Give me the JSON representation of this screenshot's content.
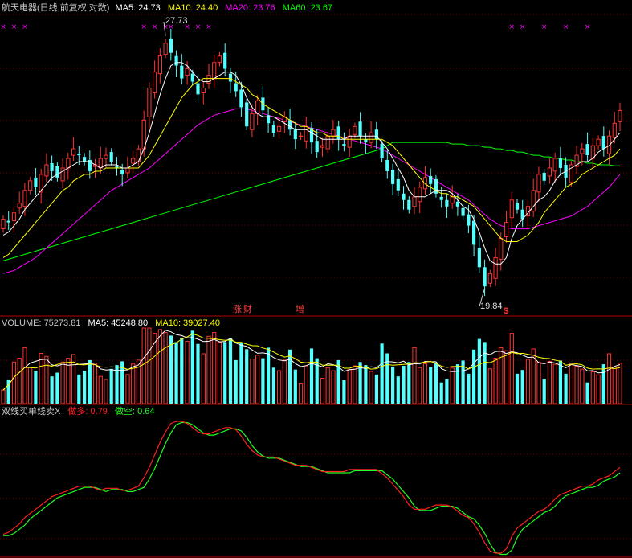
{
  "colors": {
    "background": "#000000",
    "up": "#ff3232",
    "down": "#54ffff",
    "ma5": "#ffffff",
    "ma10": "#ffff00",
    "ma20": "#ff00ff",
    "ma60": "#00ff00",
    "grid": "#7a0000",
    "divider": "#b00000",
    "label": "#c0c0c0",
    "red_line": "#ff2020",
    "green_line": "#20ff20"
  },
  "price_panel": {
    "title": "航天电器(日线,前复权,对数)",
    "ma5_label": "MA5: 24.73",
    "ma10_label": "MA10: 24.40",
    "ma20_label": "MA20: 23.76",
    "ma60_label": "MA60: 23.67",
    "high_label": "27.73",
    "low_label": "19.84",
    "markers": [
      "涨",
      "财",
      "增",
      "$"
    ]
  },
  "volume_panel": {
    "volume_label": "VOLUME: 75273.81",
    "ma5_label": "MA5: 45248.80",
    "ma10_label": "MA10: 39027.40"
  },
  "indicator_panel": {
    "title": "双线买单线卖X",
    "long_label": "做多: 0.79",
    "short_label": "做空: 0.64"
  },
  "chart_data": [
    {
      "type": "candlestick",
      "title": "航天电器(日线,前复权,对数)",
      "y_range": [
        19.0,
        28.4
      ],
      "annotations": {
        "high": 27.73,
        "low": 19.84
      },
      "close": [
        22.0,
        21.9,
        22.2,
        22.5,
        22.9,
        23.2,
        23.0,
        23.4,
        23.7,
        23.5,
        23.3,
        23.6,
        23.9,
        24.2,
        24.0,
        23.8,
        23.5,
        23.7,
        23.9,
        24.0,
        23.8,
        23.6,
        23.4,
        23.6,
        23.9,
        24.2,
        25.1,
        26.1,
        26.6,
        27.1,
        27.5,
        27.2,
        26.8,
        26.4,
        26.7,
        26.3,
        25.9,
        26.1,
        26.5,
        26.9,
        27.1,
        26.7,
        26.3,
        26.0,
        25.5,
        24.9,
        25.3,
        25.7,
        25.4,
        25.0,
        24.7,
        24.9,
        25.2,
        24.8,
        24.5,
        24.6,
        24.9,
        24.4,
        24.1,
        24.3,
        24.6,
        24.8,
        24.5,
        24.3,
        24.6,
        24.9,
        24.6,
        24.4,
        24.7,
        24.5,
        23.9,
        23.5,
        23.1,
        22.9,
        22.6,
        22.3,
        22.7,
        23.0,
        23.3,
        23.1,
        22.8,
        22.6,
        22.4,
        22.7,
        22.4,
        22.1,
        21.8,
        21.2,
        20.5,
        19.9,
        20.3,
        20.8,
        21.4,
        21.9,
        22.6,
        22.3,
        22.0,
        22.4,
        22.9,
        23.4,
        23.2,
        23.6,
        23.9,
        23.6,
        23.3,
        23.7,
        24.0,
        24.2,
        24.0,
        24.3,
        24.5,
        24.2,
        24.6,
        25.0,
        25.4
      ],
      "ma5": [
        21.5,
        21.6,
        21.8,
        22.0,
        22.3,
        22.5,
        22.7,
        22.9,
        23.1,
        23.3,
        23.4,
        23.5,
        23.6,
        23.7,
        23.8,
        23.8,
        23.8,
        23.7,
        23.6,
        23.7,
        23.7,
        23.7,
        23.6,
        23.6,
        23.7,
        23.8,
        24.2,
        24.7,
        25.3,
        25.9,
        26.4,
        26.8,
        26.9,
        26.9,
        26.8,
        26.6,
        26.4,
        26.3,
        26.3,
        26.4,
        26.5,
        26.6,
        26.6,
        26.5,
        26.2,
        25.8,
        25.5,
        25.3,
        25.2,
        25.2,
        25.2,
        25.1,
        25.0,
        24.9,
        24.8,
        24.8,
        24.8,
        24.7,
        24.6,
        24.5,
        24.5,
        24.5,
        24.5,
        24.5,
        24.6,
        24.6,
        24.6,
        24.6,
        24.6,
        24.6,
        24.4,
        24.2,
        23.9,
        23.6,
        23.3,
        22.9,
        22.7,
        22.7,
        22.7,
        22.8,
        22.9,
        22.9,
        22.9,
        22.8,
        22.6,
        22.4,
        22.3,
        22.0,
        21.6,
        21.1,
        20.7,
        20.6,
        20.6,
        20.8,
        21.4,
        21.8,
        22.0,
        22.2,
        22.4,
        22.6,
        22.7,
        22.9,
        23.2,
        23.4,
        23.5,
        23.6,
        23.7,
        23.8,
        23.8,
        23.9,
        24.1,
        24.2,
        24.3,
        24.5,
        24.7
      ],
      "ma10": [
        20.8,
        20.9,
        21.1,
        21.3,
        21.5,
        21.7,
        21.9,
        22.1,
        22.3,
        22.5,
        22.7,
        22.9,
        23.0,
        23.2,
        23.3,
        23.4,
        23.4,
        23.5,
        23.5,
        23.6,
        23.6,
        23.6,
        23.6,
        23.6,
        23.6,
        23.6,
        23.8,
        24.0,
        24.3,
        24.6,
        24.9,
        25.2,
        25.5,
        25.8,
        26.0,
        26.2,
        26.3,
        26.4,
        26.4,
        26.4,
        26.4,
        26.4,
        26.4,
        26.3,
        26.2,
        26.1,
        25.9,
        25.8,
        25.6,
        25.5,
        25.4,
        25.3,
        25.2,
        25.1,
        25.0,
        24.9,
        24.9,
        24.8,
        24.7,
        24.7,
        24.6,
        24.6,
        24.6,
        24.5,
        24.5,
        24.5,
        24.5,
        24.5,
        24.5,
        24.5,
        24.5,
        24.4,
        24.3,
        24.1,
        23.9,
        23.7,
        23.5,
        23.3,
        23.1,
        23.0,
        22.9,
        22.8,
        22.8,
        22.7,
        22.7,
        22.6,
        22.5,
        22.4,
        22.2,
        22.0,
        21.8,
        21.6,
        21.4,
        21.3,
        21.3,
        21.3,
        21.4,
        21.5,
        21.7,
        21.9,
        22.2,
        22.4,
        22.6,
        22.8,
        23.0,
        23.1,
        23.2,
        23.4,
        23.5,
        23.6,
        23.7,
        23.8,
        23.9,
        24.0,
        24.2
      ],
      "ma20": [
        20.3,
        20.35,
        20.4,
        20.5,
        20.6,
        20.7,
        20.8,
        20.95,
        21.1,
        21.25,
        21.4,
        21.55,
        21.7,
        21.85,
        22.0,
        22.15,
        22.3,
        22.45,
        22.6,
        22.75,
        22.9,
        23.0,
        23.1,
        23.2,
        23.3,
        23.4,
        23.5,
        23.6,
        23.75,
        23.9,
        24.05,
        24.2,
        24.35,
        24.5,
        24.65,
        24.8,
        24.95,
        25.05,
        25.15,
        25.25,
        25.3,
        25.35,
        25.4,
        25.45,
        25.45,
        25.45,
        25.4,
        25.35,
        25.3,
        25.25,
        25.2,
        25.15,
        25.1,
        25.05,
        25.0,
        24.95,
        24.9,
        24.85,
        24.8,
        24.75,
        24.7,
        24.65,
        24.6,
        24.55,
        24.5,
        24.45,
        24.4,
        24.35,
        24.3,
        24.25,
        24.2,
        24.1,
        24.0,
        23.9,
        23.8,
        23.7,
        23.6,
        23.5,
        23.4,
        23.3,
        23.2,
        23.1,
        23.0,
        22.9,
        22.8,
        22.7,
        22.6,
        22.45,
        22.3,
        22.15,
        22.0,
        21.9,
        21.8,
        21.75,
        21.7,
        21.7,
        21.7,
        21.7,
        21.75,
        21.8,
        21.85,
        21.9,
        21.95,
        22.0,
        22.05,
        22.1,
        22.2,
        22.3,
        22.4,
        22.55,
        22.7,
        22.85,
        23.0,
        23.2,
        23.4
      ],
      "ma60": [
        20.7,
        20.75,
        20.8,
        20.85,
        20.9,
        20.95,
        21.0,
        21.05,
        21.1,
        21.15,
        21.2,
        21.25,
        21.3,
        21.35,
        21.4,
        21.45,
        21.5,
        21.55,
        21.6,
        21.65,
        21.7,
        21.75,
        21.8,
        21.85,
        21.9,
        21.95,
        22.0,
        22.05,
        22.1,
        22.15,
        22.2,
        22.25,
        22.3,
        22.35,
        22.4,
        22.45,
        22.5,
        22.55,
        22.6,
        22.65,
        22.7,
        22.75,
        22.8,
        22.85,
        22.9,
        22.95,
        23.0,
        23.05,
        23.1,
        23.15,
        23.2,
        23.25,
        23.3,
        23.35,
        23.4,
        23.45,
        23.5,
        23.55,
        23.6,
        23.65,
        23.7,
        23.75,
        23.8,
        23.85,
        23.9,
        23.95,
        24.0,
        24.05,
        24.1,
        24.15,
        24.2,
        24.3,
        24.4,
        24.4,
        24.4,
        24.4,
        24.4,
        24.4,
        24.4,
        24.4,
        24.4,
        24.4,
        24.4,
        24.35,
        24.35,
        24.35,
        24.3,
        24.3,
        24.3,
        24.25,
        24.25,
        24.2,
        24.2,
        24.15,
        24.15,
        24.1,
        24.1,
        24.05,
        24.0,
        24.0,
        23.95,
        23.95,
        23.9,
        23.9,
        23.85,
        23.85,
        23.8,
        23.8,
        23.75,
        23.75,
        23.7,
        23.7,
        23.7,
        23.67,
        23.67
      ]
    },
    {
      "type": "bar",
      "title": "VOLUME",
      "y_range": [
        0,
        80000
      ],
      "last_value": 75273.81,
      "ma5_last": 45248.8,
      "ma10_last": 39027.4
    },
    {
      "type": "line",
      "title": "双线买单线卖X",
      "series": [
        {
          "name": "做多",
          "color": "#ff2020"
        },
        {
          "name": "做空",
          "color": "#20ff20"
        }
      ],
      "last_values": {
        "做多": 0.79,
        "做空": 0.64
      }
    }
  ]
}
